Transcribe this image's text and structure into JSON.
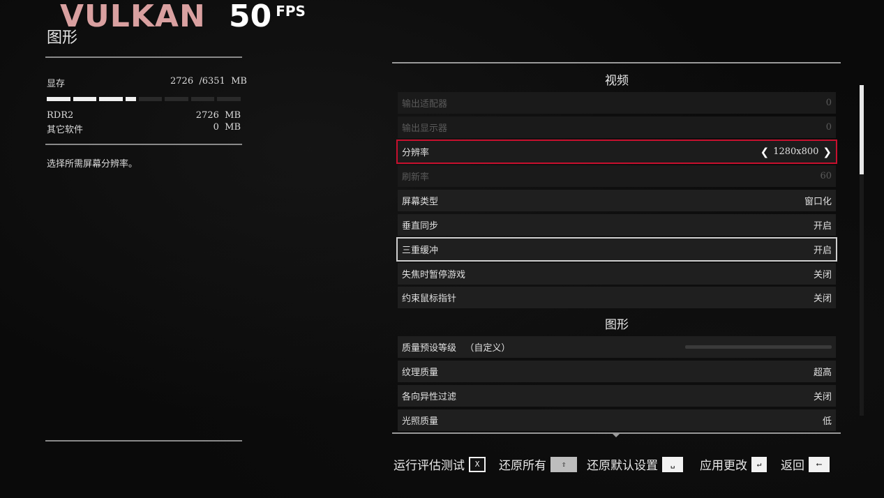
{
  "overlay": {
    "api": "VULKAN",
    "fps_value": "50",
    "fps_unit": "FPS"
  },
  "left": {
    "title": "图形",
    "vram": {
      "label": "显存",
      "value": "2726  /6351  MB",
      "used_fraction": 0.43,
      "segments_on": 4,
      "segments_total": 8
    },
    "usage": [
      {
        "name": "RDR2",
        "value": "2726  MB"
      },
      {
        "name": "其它软件",
        "value": "0  MB"
      }
    ],
    "description": "选择所需屏幕分辨率。"
  },
  "panel": {
    "video_header": "视频",
    "graphics_header": "图形",
    "rows": [
      {
        "label": "输出适配器",
        "value": "0",
        "state": "disabled"
      },
      {
        "label": "输出显示器",
        "value": "0",
        "state": "disabled"
      },
      {
        "label": "分辨率",
        "value": "1280x800",
        "state": "selected",
        "chevrons": true
      },
      {
        "label": "刷新率",
        "value": "60",
        "state": "disabled"
      },
      {
        "label": "屏幕类型",
        "value": "窗口化",
        "state": "normal"
      },
      {
        "label": "垂直同步",
        "value": "开启",
        "state": "normal"
      },
      {
        "label": "三重缓冲",
        "value": "开启",
        "state": "hovered"
      },
      {
        "label": "失焦时暂停游戏",
        "value": "关闭",
        "state": "normal"
      },
      {
        "label": "约束鼠标指针",
        "value": "关闭",
        "state": "normal"
      }
    ],
    "graphics_rows": [
      {
        "label": "质量预设等级   （自定义）",
        "value": "",
        "state": "normal",
        "preset_bar": true
      },
      {
        "label": "纹理质量",
        "value": "超高",
        "state": "normal"
      },
      {
        "label": "各向异性过滤",
        "value": "关闭",
        "state": "normal"
      },
      {
        "label": "光照质量",
        "value": "低",
        "state": "normal"
      }
    ]
  },
  "footer": {
    "run_benchmark": {
      "label": "运行评估测试",
      "key": "X"
    },
    "restore_all": {
      "label": "还原所有",
      "key": "⇧"
    },
    "restore_defaults": {
      "label": "还原默认设置",
      "key": "␣"
    },
    "apply_changes": {
      "label": "应用更改",
      "key": "↵"
    },
    "back": {
      "label": "返回",
      "key": "⟵"
    }
  },
  "colors": {
    "accent_red": "#c8102e",
    "api_text": "#d9a0a0"
  }
}
